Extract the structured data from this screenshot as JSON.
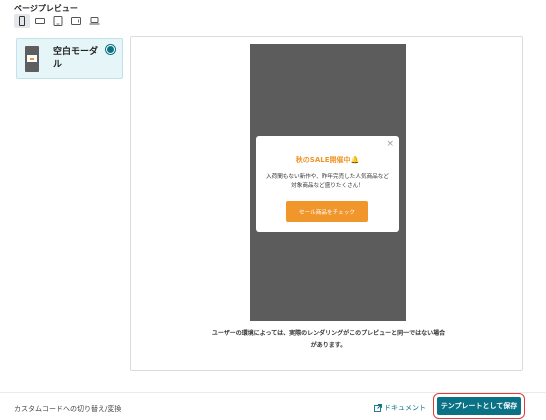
{
  "page_title": "ページプレビュー",
  "device_tabs": [
    {
      "icon": "mobile-icon",
      "active": true
    },
    {
      "icon": "mobile-landscape-icon",
      "active": false
    },
    {
      "icon": "tablet-icon",
      "active": false
    },
    {
      "icon": "tablet-landscape-icon",
      "active": false
    },
    {
      "icon": "laptop-icon",
      "active": false
    }
  ],
  "templates": [
    {
      "label": "空白モーダル",
      "selected": true
    }
  ],
  "preview": {
    "modal": {
      "title": "秋のSALE開催中🔔",
      "body": "入荷間もない新作や、昨年完売した人気商品など対象商品など盛りたくさん！",
      "button": "セール商品をチェック",
      "close": "×"
    },
    "notice": "ユーザーの環境によっては、実際のレンダリングがこのプレビューと同一ではない場合があります。"
  },
  "footer": {
    "custom_code": "カスタムコードへの切り替え/変換",
    "doc_link": "ドキュメント",
    "save_button": "テンプレートとして保存"
  },
  "colors": {
    "accent": "#0b7285",
    "orange": "#f0962b",
    "overlay": "#5c5c5c"
  }
}
